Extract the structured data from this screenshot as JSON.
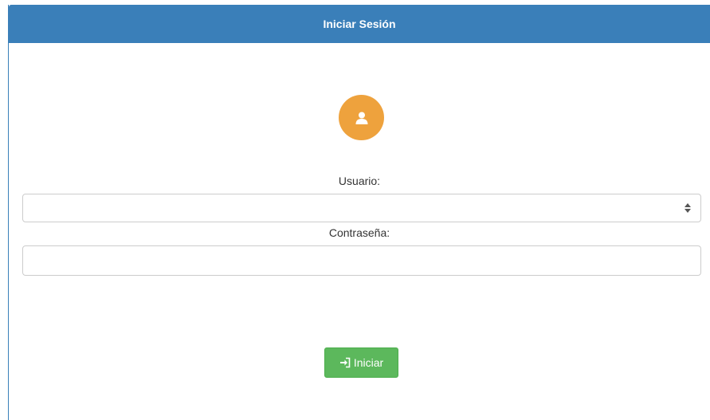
{
  "header": {
    "title": "Iniciar Sesión"
  },
  "avatar": {
    "icon": "user-icon",
    "color": "#eea23d"
  },
  "form": {
    "user_label": "Usuario:",
    "user_value": "",
    "password_label": "Contraseña:",
    "password_value": ""
  },
  "submit": {
    "icon": "log-in-icon",
    "label": "Iniciar"
  },
  "colors": {
    "header": "#3a7fb9",
    "button": "#5cb85c"
  }
}
